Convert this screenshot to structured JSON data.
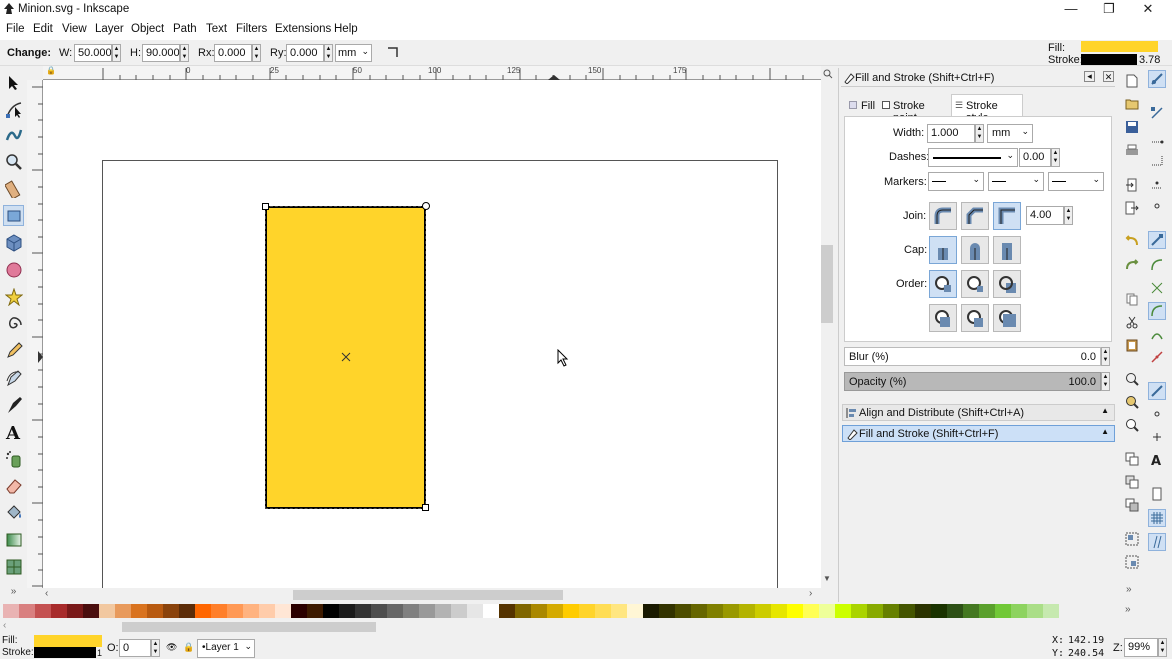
{
  "window": {
    "title": "Minion.svg - Inkscape",
    "minimize": "—",
    "maximize": "❐",
    "close": "✕"
  },
  "menu": [
    "File",
    "Edit",
    "View",
    "Layer",
    "Object",
    "Path",
    "Text",
    "Filters",
    "Extensions",
    "Help"
  ],
  "toolcontrols": {
    "change_label": "Change:",
    "w_label": "W:",
    "w_value": "50.000",
    "h_label": "H:",
    "h_value": "90.000",
    "rx_label": "Rx:",
    "rx_value": "0.000",
    "ry_label": "Ry:",
    "ry_value": "0.000",
    "unit": "mm"
  },
  "style_indicator": {
    "fill_label": "Fill:",
    "stroke_label": "Stroke:",
    "stroke_width": "3.78",
    "fill_color": "#ffd42a",
    "stroke_color": "#000000"
  },
  "ruler": {
    "labels": [
      "0",
      "25",
      "50",
      "75",
      "100",
      "125",
      "150",
      "175"
    ]
  },
  "canvas": {
    "rect_fill": "#ffd42a",
    "rect_stroke": "#000000"
  },
  "panel": {
    "title": "Fill and Stroke (Shift+Ctrl+F)",
    "tabs": [
      "Fill",
      "Stroke paint",
      "Stroke style"
    ],
    "width_label": "Width:",
    "width_value": "1.000",
    "width_unit": "mm",
    "dashes_label": "Dashes:",
    "dashes_offset": "0.00",
    "markers_label": "Markers:",
    "join_label": "Join:",
    "miter_value": "4.00",
    "cap_label": "Cap:",
    "order_label": "Order:",
    "blur_label": "Blur (%)",
    "blur_value": "0.0",
    "opacity_label": "Opacity (%)",
    "opacity_value": "100.0",
    "docked": [
      "Align and Distribute (Shift+Ctrl+A)",
      "Fill and Stroke (Shift+Ctrl+F)"
    ]
  },
  "status": {
    "fill_label": "Fill:",
    "stroke_label": "Stroke:",
    "stroke_width": "1",
    "opacity_label": "O:",
    "opacity_value": "0",
    "layer": "•Layer 1",
    "x_label": "X:",
    "x_value": "142.19",
    "y_label": "Y:",
    "y_value": "240.54",
    "zoom_label": "Z:",
    "zoom_value": "99%"
  },
  "palette_colors": [
    "#e9b3b3",
    "#d98080",
    "#c45151",
    "#a82b2b",
    "#7a1919",
    "#4a0e0e",
    "#f2c8a0",
    "#e89a5c",
    "#d9731f",
    "#b85a10",
    "#8a430c",
    "#5c2c08",
    "#ff6600",
    "#ff7f2a",
    "#ff9955",
    "#ffb380",
    "#ffccaa",
    "#ffe6d5",
    "#2b0000",
    "#3d1a00",
    "#000000",
    "#1a1a1a",
    "#333333",
    "#4d4d4d",
    "#666666",
    "#808080",
    "#999999",
    "#b3b3b3",
    "#cccccc",
    "#e6e6e6",
    "#ffffff",
    "#553300",
    "#806600",
    "#aa8800",
    "#d4aa00",
    "#ffcc00",
    "#ffd42a",
    "#ffdd55",
    "#ffe680",
    "#fff6d5",
    "#1a1a00",
    "#333300",
    "#4d4d00",
    "#666600",
    "#808000",
    "#999900",
    "#b3b300",
    "#cccc00",
    "#e6e600",
    "#ffff00",
    "#ffff55",
    "#eeff99",
    "#ccff00",
    "#aad400",
    "#88aa00",
    "#668000",
    "#445500",
    "#2b3300",
    "#1a3300",
    "#2d5016",
    "#447821",
    "#5aa02c",
    "#71c837",
    "#8dd35f",
    "#aade87",
    "#c6e9af"
  ]
}
